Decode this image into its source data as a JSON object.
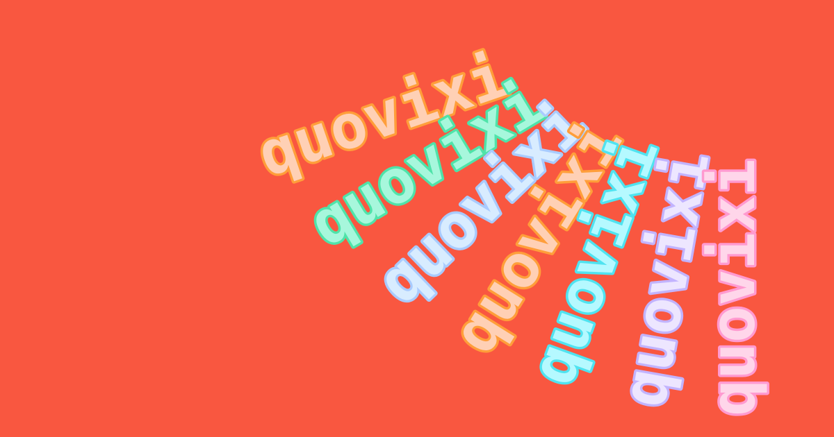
{
  "background_color": "#f95740",
  "words": [
    {
      "text": "quovixi",
      "fill": "#ffd0b5",
      "stroke": "#ff9e3a"
    },
    {
      "text": "quovixi",
      "fill": "#a7f7dc",
      "stroke": "#4fe3a9"
    },
    {
      "text": "quovixi",
      "fill": "#d8ecff",
      "stroke": "#a9cbff"
    },
    {
      "text": "quovixi",
      "fill": "#ffd0b5",
      "stroke": "#ff9e3a"
    },
    {
      "text": "quovixi",
      "fill": "#b5f9ff",
      "stroke": "#4fe3f0"
    },
    {
      "text": "quovixi",
      "fill": "#ede6ff",
      "stroke": "#c2b3ff"
    },
    {
      "text": "quovixi",
      "fill": "#ffd6ea",
      "stroke": "#ff9ad0"
    }
  ]
}
